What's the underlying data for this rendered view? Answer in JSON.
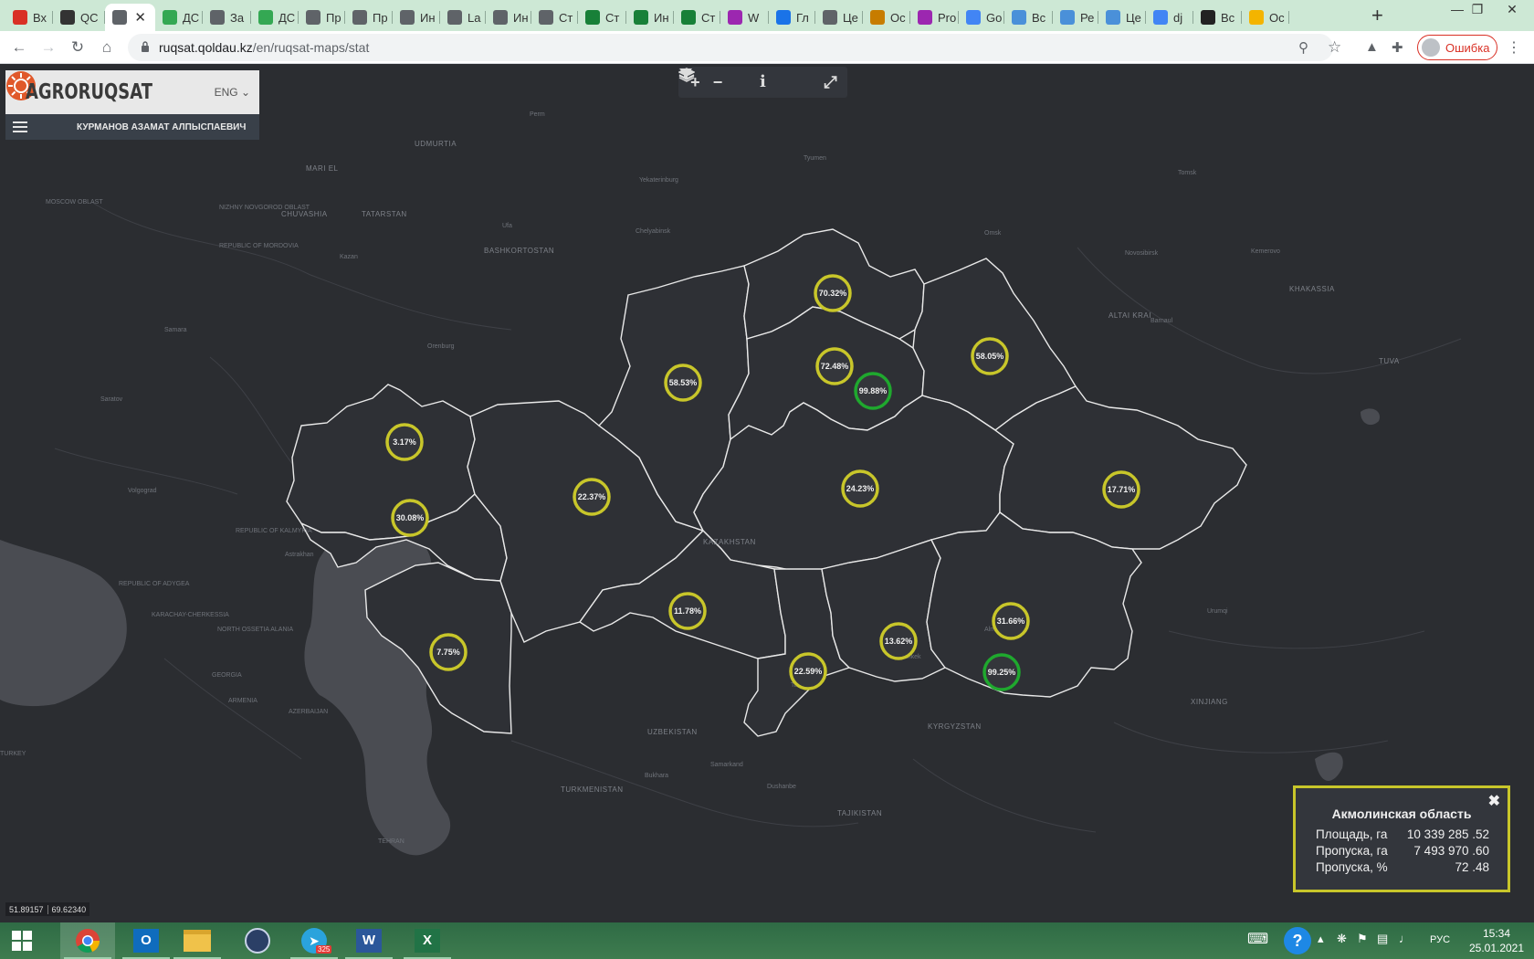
{
  "browser": {
    "tabs": [
      {
        "label": "Вх",
        "icon": "gmail-icon",
        "color": "#d93025"
      },
      {
        "label": "QC",
        "icon": "qoldau-icon",
        "color": "#333333"
      },
      {
        "label": "",
        "icon": "globe-icon",
        "color": "#5f6368",
        "active": true
      },
      {
        "label": "ДС",
        "icon": "leaf-icon",
        "color": "#34a853"
      },
      {
        "label": "За",
        "icon": "qoldau-icon",
        "color": "#5f6368"
      },
      {
        "label": "ДС",
        "icon": "leaf-icon",
        "color": "#34a853"
      },
      {
        "label": "Пр",
        "icon": "qoldau-icon",
        "color": "#5f6368"
      },
      {
        "label": "Пр",
        "icon": "qoldau-icon",
        "color": "#5f6368"
      },
      {
        "label": "Ин",
        "icon": "qoldau-icon",
        "color": "#5f6368"
      },
      {
        "label": "La",
        "icon": "qoldau-icon",
        "color": "#5f6368"
      },
      {
        "label": "Ин",
        "icon": "qoldau-icon",
        "color": "#5f6368"
      },
      {
        "label": "Ст",
        "icon": "qoldau-icon",
        "color": "#5f6368"
      },
      {
        "label": "Ст",
        "icon": "sheets-icon",
        "color": "#188038"
      },
      {
        "label": "Ин",
        "icon": "sheets-icon",
        "color": "#188038"
      },
      {
        "label": "Ст",
        "icon": "sheets-icon",
        "color": "#188038"
      },
      {
        "label": "W",
        "icon": "wheat-icon",
        "color": "#9c27b0"
      },
      {
        "label": "Гл",
        "icon": "wave-icon",
        "color": "#1a73e8"
      },
      {
        "label": "Це",
        "icon": "qoldau-icon",
        "color": "#5f6368"
      },
      {
        "label": "Ос",
        "icon": "ring-icon",
        "color": "#c77c00"
      },
      {
        "label": "Pro",
        "icon": "wheat-icon",
        "color": "#9c27b0"
      },
      {
        "label": "Go",
        "icon": "translate-icon",
        "color": "#4285f4"
      },
      {
        "label": "Вс",
        "icon": "un-icon",
        "color": "#4a90d9"
      },
      {
        "label": "Ре",
        "icon": "un-icon",
        "color": "#4a90d9"
      },
      {
        "label": "Це",
        "icon": "un-icon",
        "color": "#4a90d9"
      },
      {
        "label": "dj",
        "icon": "google-icon",
        "color": "#4285f4"
      },
      {
        "label": "Вс",
        "icon": "r-icon",
        "color": "#222222"
      },
      {
        "label": "Ос",
        "icon": "folder-icon",
        "color": "#f4b400"
      }
    ],
    "url_host": "ruqsat.qoldau.kz",
    "url_path": "/en/ruqsat-maps/stat",
    "profile_label": "Ошибка"
  },
  "app": {
    "logo_text": "AGRORUQSAT",
    "language": "ENG",
    "user_name": "КУРМАНОВ АЗАМАТ АЛПЫСПАЕВИЧ"
  },
  "map": {
    "markers": [
      {
        "label": "70.32%",
        "status": "partial"
      },
      {
        "label": "58.05%",
        "status": "partial"
      },
      {
        "label": "58.53%",
        "status": "partial"
      },
      {
        "label": "72.48%",
        "status": "partial"
      },
      {
        "label": "99.88%",
        "status": "complete"
      },
      {
        "label": "3.17%",
        "status": "partial"
      },
      {
        "label": "22.37%",
        "status": "partial"
      },
      {
        "label": "24.23%",
        "status": "partial"
      },
      {
        "label": "17.71%",
        "status": "partial"
      },
      {
        "label": "30.08%",
        "status": "partial"
      },
      {
        "label": "11.78%",
        "status": "partial"
      },
      {
        "label": "31.66%",
        "status": "partial"
      },
      {
        "label": "7.75%",
        "status": "partial"
      },
      {
        "label": "13.62%",
        "status": "partial"
      },
      {
        "label": "22.59%",
        "status": "partial"
      },
      {
        "label": "99.25%",
        "status": "complete"
      }
    ],
    "colors": {
      "partial": "#c8c62a",
      "complete": "#1fa82e"
    },
    "labels": {
      "kazakhstan": "KAZAKHSTAN",
      "uzbekistan": "UZBEKISTAN",
      "turkmenistan": "TURKMENISTAN",
      "kyrgyzstan": "KYRGYZSTAN",
      "tajikistan": "TAJIKISTAN",
      "xinjiang": "XINJIANG",
      "khakassia": "KHAKASSIA",
      "altai_krai": "ALTAI KRAI",
      "tuva": "TUVA",
      "bashkortostan": "BASHKORTOSTAN",
      "tatarstan": "TATARSTAN",
      "chuvashia": "CHUVASHIA",
      "udmurtia": "UDMURTIA",
      "mari_el": "MARI EL",
      "nizhny": "NIZHNY NOVGOROD OBLAST",
      "mordovia": "REPUBLIC OF MORDOVIA",
      "moscow": "MOSCOW OBLAST",
      "kalmykia": "REPUBLIC OF KALMYKIA",
      "adygea": "REPUBLIC OF ADYGEA",
      "karachay": "KARACHAY-CHERKESSIA",
      "north_ossetia": "NORTH OSSETIA ALANIA",
      "georgia": "GEORGIA",
      "armenia": "ARMENIA",
      "azerbaijan": "AZERBAIJAN",
      "turkey": "TURKEY",
      "tehran": "TEHRAN",
      "almaty": "Almaty",
      "bishkek": "Bishkek",
      "tashkent": "Tashkent",
      "dushanbe": "Dushanbe",
      "urumqi": "Urumqi",
      "samara": "Samara",
      "saratov": "Saratov",
      "volgograd": "Volgograd",
      "ufa": "Ufa",
      "kazan": "Kazan",
      "perm": "Perm",
      "tyumen": "Tyumen",
      "omsk": "Omsk",
      "novosibirsk": "Novosibirsk",
      "barnaul": "Barnaul",
      "tomsk": "Tomsk",
      "kemerovo": "Kemerovo",
      "yekaterinburg": "Yekaterinburg",
      "chelyabinsk": "Chelyabinsk",
      "orenburg": "Orenburg",
      "astrakhan": "Astrakhan",
      "bukhara": "Bukhara",
      "samarkand": "Samarkand"
    },
    "coords": {
      "lat": "51.89157",
      "lon": "69.62340"
    }
  },
  "info_panel": {
    "title": "Акмолинская область",
    "rows": [
      {
        "label": "Площадь, га",
        "value": "10 339 285 .52"
      },
      {
        "label": "Пропуска, га",
        "value": "7 493 970 .60"
      },
      {
        "label": "Пропуска, %",
        "value": "72 .48"
      }
    ]
  },
  "taskbar": {
    "telegram_badge": "325",
    "lang": "РУС",
    "time": "15:34",
    "date": "25.01.2021"
  }
}
